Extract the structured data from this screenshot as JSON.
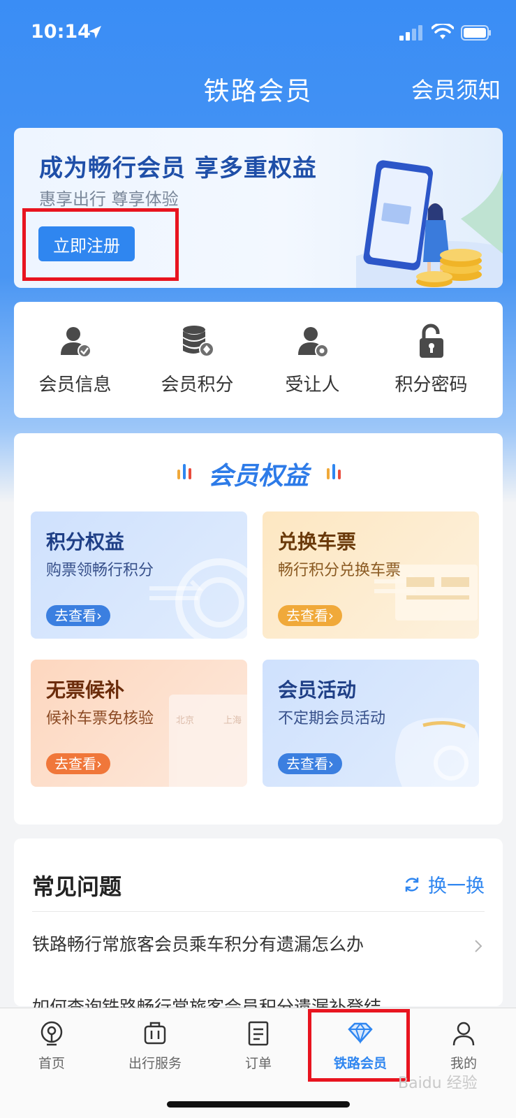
{
  "status_bar": {
    "time": "10:14"
  },
  "nav": {
    "title": "铁路会员",
    "right_action": "会员须知"
  },
  "banner": {
    "title": "成为畅行会员  享多重权益",
    "subtitle": "惠享出行 尊享体验",
    "register_label": "立即注册"
  },
  "quick_actions": [
    {
      "label": "会员信息",
      "icon": "member-info-icon"
    },
    {
      "label": "会员积分",
      "icon": "points-coins-icon"
    },
    {
      "label": "受让人",
      "icon": "assignee-icon"
    },
    {
      "label": "积分密码",
      "icon": "lock-icon"
    }
  ],
  "benefits": {
    "title": "会员权益",
    "tiles": [
      {
        "title": "积分权益",
        "subtitle": "购票领畅行积分",
        "button": "去查看›"
      },
      {
        "title": "兑换车票",
        "subtitle": "畅行积分兑换车票",
        "button": "去查看›"
      },
      {
        "title": "无票候补",
        "subtitle": "候补车票免核验",
        "button": "去查看›"
      },
      {
        "title": "会员活动",
        "subtitle": "不定期会员活动",
        "button": "去查看›"
      }
    ],
    "ticket_deco": {
      "from": "北京",
      "to": "上海"
    }
  },
  "faq": {
    "title": "常见问题",
    "refresh_label": "换一换",
    "items": [
      "铁路畅行常旅客会员乘车积分有遗漏怎么办",
      "如何查询铁路畅行常旅客会员积分遗漏补登结"
    ]
  },
  "tabbar": {
    "tabs": [
      {
        "label": "首页",
        "icon": "home-train-icon"
      },
      {
        "label": "出行服务",
        "icon": "luggage-icon"
      },
      {
        "label": "订单",
        "icon": "order-doc-icon"
      },
      {
        "label": "铁路会员",
        "icon": "diamond-icon"
      },
      {
        "label": "我的",
        "icon": "person-icon"
      }
    ],
    "active_tab": "铁路会员"
  },
  "watermark": "Baidu 经验",
  "colors": {
    "primary": "#2f86f0",
    "highlight_box": "#e8141f"
  }
}
